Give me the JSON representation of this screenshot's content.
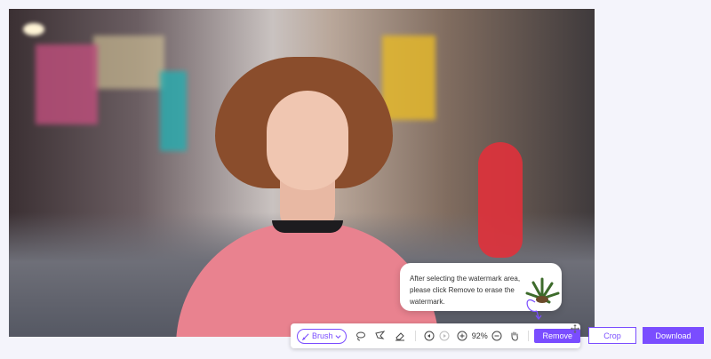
{
  "tooltip": {
    "text": "After selecting the watermark area, please click Remove to erase the watermark."
  },
  "toolbar": {
    "brush_label": "Brush",
    "zoom_level": "92%",
    "remove_label": "Remove",
    "icons": [
      "lasso-icon",
      "polygon-lasso-icon",
      "eraser-icon",
      "undo-icon",
      "redo-icon",
      "zoom-in-icon",
      "zoom-out-icon",
      "hand-icon",
      "move-icon"
    ]
  },
  "actions": {
    "crop_label": "Crop",
    "download_label": "Download"
  },
  "colors": {
    "accent": "#7a4dff",
    "watermark_mask": "#e0313b"
  }
}
